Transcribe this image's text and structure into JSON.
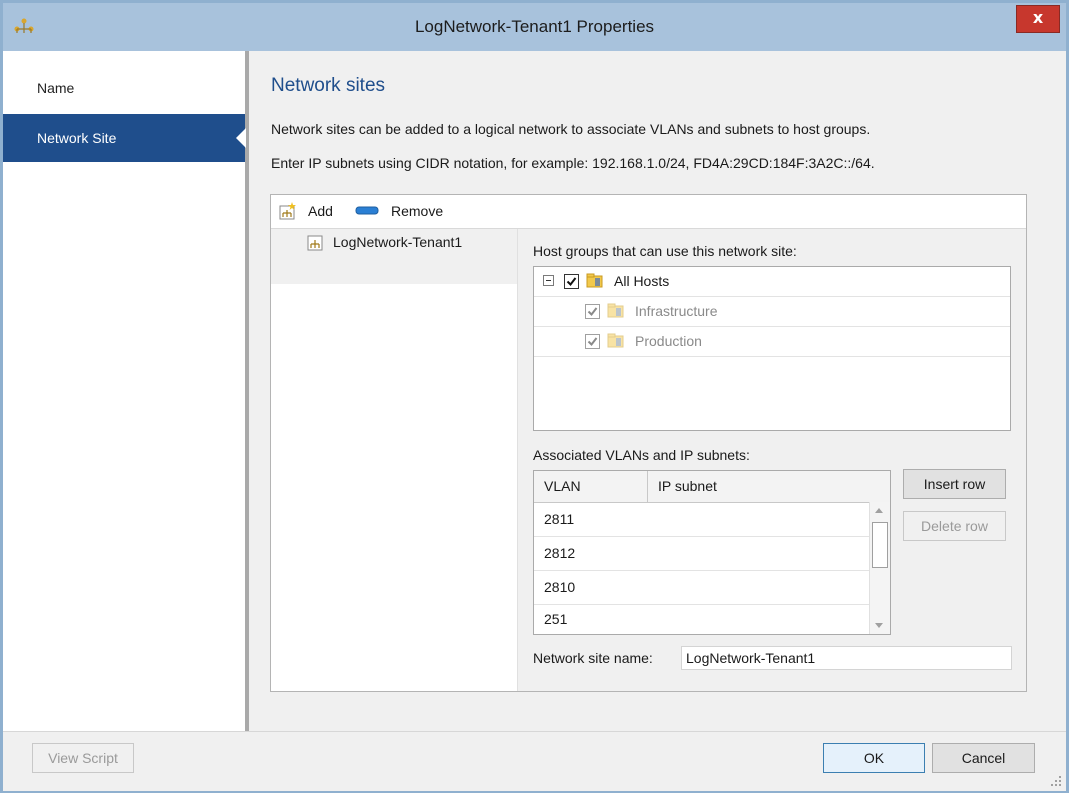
{
  "window": {
    "title": "LogNetwork-Tenant1 Properties",
    "close_label": "x"
  },
  "sidebar": {
    "items": [
      {
        "label": "Name",
        "active": false
      },
      {
        "label": "Network Site",
        "active": true
      }
    ]
  },
  "main": {
    "heading": "Network sites",
    "description": "Network sites can be added to a logical network to associate VLANs and subnets to host groups.",
    "cidr_hint": "Enter IP subnets using CIDR notation, for example: 192.168.1.0/24, FD4A:29CD:184F:3A2C::/64.",
    "toolbar": {
      "add_label": "Add",
      "remove_label": "Remove"
    },
    "sites": [
      {
        "label": "LogNetwork-Tenant1"
      }
    ],
    "host_groups_label": "Host groups that can use this network site:",
    "host_groups": [
      {
        "label": "All Hosts",
        "checked": true,
        "enabled": true
      },
      {
        "label": "Infrastructure",
        "checked": true,
        "enabled": false
      },
      {
        "label": "Production",
        "checked": true,
        "enabled": false
      }
    ],
    "vlan_label": "Associated VLANs and IP subnets:",
    "vlan_columns": [
      "VLAN",
      "IP subnet"
    ],
    "vlan_rows": [
      {
        "vlan": "2811",
        "subnet": ""
      },
      {
        "vlan": "2812",
        "subnet": ""
      },
      {
        "vlan": "2810",
        "subnet": ""
      },
      {
        "vlan": "251",
        "subnet": ""
      }
    ],
    "insert_row_label": "Insert row",
    "delete_row_label": "Delete row",
    "site_name_label": "Network site name:",
    "site_name_value": "LogNetwork-Tenant1"
  },
  "footer": {
    "view_script_label": "View Script",
    "ok_label": "OK",
    "cancel_label": "Cancel"
  },
  "colors": {
    "accent": "#1f4e8c",
    "titlebar": "#a8c2dc",
    "close": "#c7372d"
  }
}
